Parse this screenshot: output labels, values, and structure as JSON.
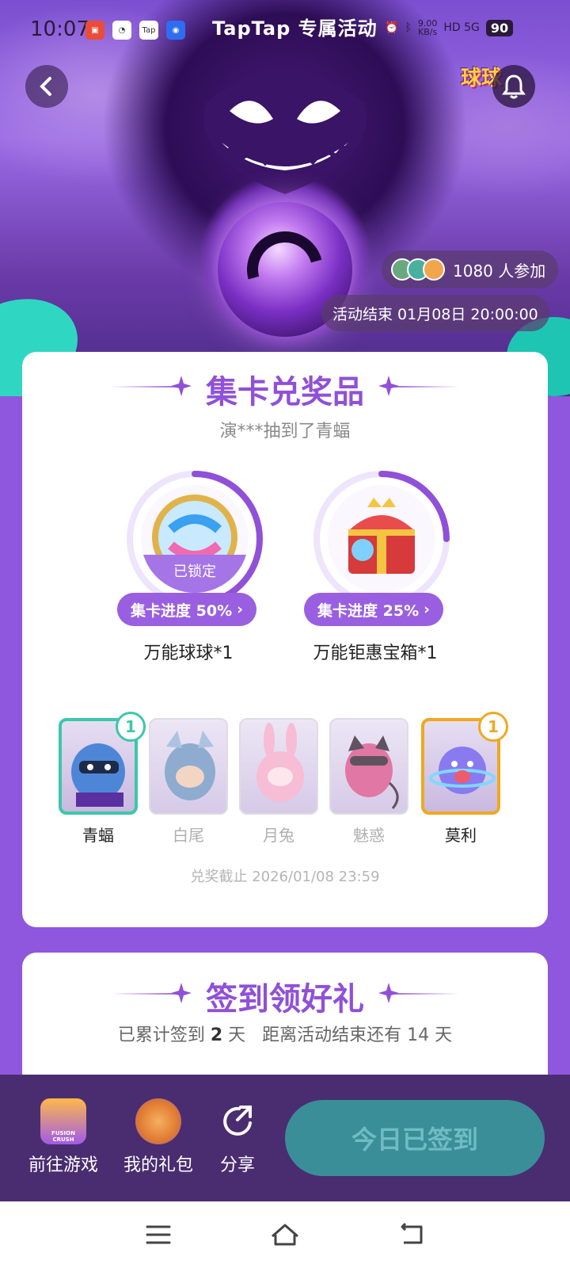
{
  "status_bar": {
    "time": "10:07",
    "banner": "TapTap 专属活动",
    "speed": "9.00\nKB/s",
    "network": "HD 5G",
    "battery": "90"
  },
  "hero": {
    "participants": "1080 人参加",
    "end_time": "活动结束 01月08日 20:00:00",
    "logo_text": "球球"
  },
  "collect_section": {
    "title": "集卡兑奖品",
    "ticker": "演***抽到了青蝠",
    "prizes": [
      {
        "name": "万能球球*1",
        "progress_label": "集卡进度 50%",
        "progress": 0.5,
        "locked_label": "已锁定"
      },
      {
        "name": "万能钜惠宝箱*1",
        "progress_label": "集卡进度 25%",
        "progress": 0.25
      }
    ],
    "characters": [
      {
        "name": "青蝠",
        "count": "1",
        "owned": true
      },
      {
        "name": "白尾",
        "owned": false
      },
      {
        "name": "月兔",
        "owned": false
      },
      {
        "name": "魅惑",
        "owned": false
      },
      {
        "name": "莫利",
        "count": "1",
        "owned": true
      }
    ],
    "deadline": "兑奖截止 2026/01/08 23:59"
  },
  "signin_section": {
    "title": "签到领好礼",
    "info_prefix": "已累计签到",
    "days": "2",
    "info_suffix": "天   距离活动结束还有 14 天"
  },
  "action_bar": {
    "goto_game": "前往游戏",
    "my_gifts": "我的礼包",
    "share": "分享",
    "signin_button": "今日已签到",
    "game_icon_text": "FUSION CRUSH"
  },
  "colors": {
    "brand_purple": "#9050d8",
    "background": "#8f57dd",
    "teal": "#3cc7a9",
    "gold": "#f0a81f",
    "action_bar": "#4a2d70",
    "signed_button": "#3a8e98"
  }
}
